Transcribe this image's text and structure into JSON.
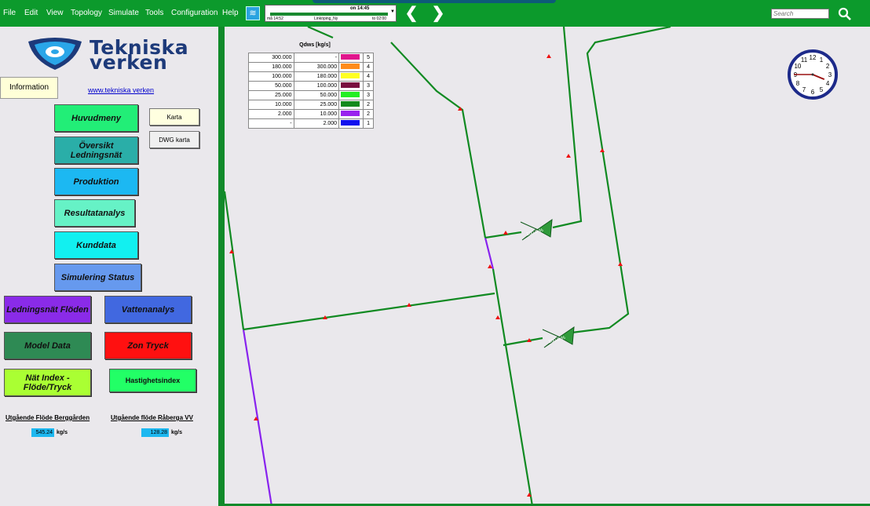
{
  "menu": {
    "items": [
      "File",
      "Edit",
      "View",
      "Topology",
      "Simulate",
      "Tools",
      "Configuration",
      "Help"
    ]
  },
  "timeline": {
    "current_time": "on 14:45",
    "start": "må 14:52",
    "location": "Linköping_Ny",
    "end": "to 02:00"
  },
  "search": {
    "placeholder": "Search"
  },
  "logo": {
    "line1": "Tekniska",
    "line2": "verken"
  },
  "sidebar": {
    "info_tab": "Information",
    "link": "www.tekniska verken",
    "buttons": {
      "huvudmeny": "Huvudmeny",
      "oversikt": "Översikt Ledningsnät",
      "produktion": "Produktion",
      "resultatanalys": "Resultatanalys",
      "kunddata": "Kunddata",
      "simulering": "Simulering Status",
      "karta": "Karta",
      "dwg_karta": "DWG karta",
      "ledningsnat_floden": "Ledningsnät Flöden",
      "vattenanalys": "Vattenanalys",
      "model_data": "Model Data",
      "zon_tryck": "Zon Tryck",
      "nat_index": "Nät Index - Flöde/Tryck",
      "hastighetsindex": "Hastighetsindex"
    },
    "colors": {
      "huvudmeny": "#22ee77",
      "oversikt": "#2aaea8",
      "produktion": "#1cb8f2",
      "resultatanalys": "#66f2c6",
      "kunddata": "#12f0f0",
      "simulering": "#6699ee",
      "karta": "#ffffe0",
      "dwg_karta": "#f0f0f0",
      "ledningsnat_floden": "#8a2be8",
      "vattenanalys": "#4168e0",
      "model_data": "#2e8a54",
      "zon_tryck": "#ff1010",
      "nat_index": "#aaff33",
      "hastighetsindex": "#22ff66"
    },
    "outflow": {
      "berggarden_label": "Utgående Flöde Berggården",
      "berggarden_value": "545.24",
      "raberga_label": "Utgående flöde Råberga VV",
      "raberga_value": "128.28",
      "unit": "kg/s"
    }
  },
  "legend": {
    "title": "Qdws [kg/s]",
    "rows": [
      {
        "from": "300.000",
        "to": "-",
        "color": "#e0168c",
        "cls": "5"
      },
      {
        "from": "180.000",
        "to": "300.000",
        "color": "#ff8c1a",
        "cls": "4"
      },
      {
        "from": "100.000",
        "to": "180.000",
        "color": "#ffff22",
        "cls": "4"
      },
      {
        "from": "50.000",
        "to": "100.000",
        "color": "#7a1040",
        "cls": "3"
      },
      {
        "from": "25.000",
        "to": "50.000",
        "color": "#22ee22",
        "cls": "3"
      },
      {
        "from": "10.000",
        "to": "25.000",
        "color": "#138a1c",
        "cls": "2"
      },
      {
        "from": "2.000",
        "to": "10.000",
        "color": "#9922ee",
        "cls": "2"
      },
      {
        "from": "-",
        "to": "2.000",
        "color": "#1111ee",
        "cls": "1"
      }
    ]
  },
  "map": {
    "valve1_label": "100.0 %",
    "valve2_label": "100.0 %",
    "pipe_color": "#118a22",
    "low_flow_color": "#8822ee",
    "arrow_color": "#ee1111"
  },
  "clock": {
    "hour": 3,
    "minute": 45,
    "numerals": [
      "12",
      "1",
      "2",
      "3",
      "4",
      "5",
      "6",
      "7",
      "8",
      "9",
      "10",
      "11"
    ]
  }
}
